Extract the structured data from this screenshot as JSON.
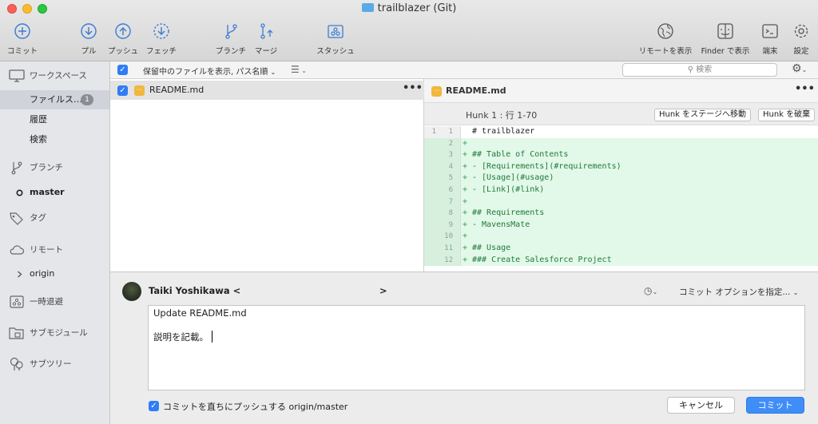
{
  "window": {
    "title": "trailblazer (Git)"
  },
  "toolbar": {
    "commit": "コミット",
    "pull": "プル",
    "push": "プッシュ",
    "fetch": "フェッチ",
    "branch": "ブランチ",
    "merge": "マージ",
    "stash": "スタッシュ",
    "show_remote": "リモートを表示",
    "show_in_finder": "Finder で表示",
    "terminal": "端末",
    "settings": "設定"
  },
  "sidebar": {
    "workspace": "ワークスペース",
    "file_status": "ファイルス…",
    "file_status_count": "1",
    "history": "履歴",
    "search": "検索",
    "branches": "ブランチ",
    "current_branch": "master",
    "tags": "タグ",
    "remotes": "リモート",
    "remote_origin": "origin",
    "stashes": "一時退避",
    "submodules": "サブモジュール",
    "subtrees": "サブツリー"
  },
  "filter": {
    "show_staged": "保留中のファイルを表示, パス名順",
    "search_placeholder": "検索"
  },
  "files": [
    {
      "name": "README.md"
    }
  ],
  "diff": {
    "file_name": "README.md",
    "hunk_label": "Hunk 1 : 行 1-70",
    "stage_hunk": "Hunk をステージへ移動",
    "discard_hunk": "Hunk を破棄",
    "lines": [
      {
        "old": "1",
        "new": "1",
        "mark": " ",
        "text": "# trailblazer",
        "added": false
      },
      {
        "old": "",
        "new": "2",
        "mark": "+",
        "text": "",
        "added": true
      },
      {
        "old": "",
        "new": "3",
        "mark": "+",
        "text": "## Table of Contents",
        "added": true
      },
      {
        "old": "",
        "new": "4",
        "mark": "+",
        "text": "- [Requirements](#requirements)",
        "added": true
      },
      {
        "old": "",
        "new": "5",
        "mark": "+",
        "text": "- [Usage](#usage)",
        "added": true
      },
      {
        "old": "",
        "new": "6",
        "mark": "+",
        "text": "- [Link](#link)",
        "added": true
      },
      {
        "old": "",
        "new": "7",
        "mark": "+",
        "text": "",
        "added": true
      },
      {
        "old": "",
        "new": "8",
        "mark": "+",
        "text": "## Requirements",
        "added": true
      },
      {
        "old": "",
        "new": "9",
        "mark": "+",
        "text": "- MavensMate",
        "added": true
      },
      {
        "old": "",
        "new": "10",
        "mark": "+",
        "text": "",
        "added": true
      },
      {
        "old": "",
        "new": "11",
        "mark": "+",
        "text": "## Usage",
        "added": true
      },
      {
        "old": "",
        "new": "12",
        "mark": "+",
        "text": "### Create Salesforce Project",
        "added": true
      }
    ]
  },
  "commit": {
    "author_name": "Taiki Yoshikawa <",
    "author_email_end": ">",
    "options": "コミット オプションを指定...",
    "message_line1": "Update README.md",
    "message_line2": "説明を記載。",
    "push_immediately": "コミットを直ちにプッシュする origin/master",
    "cancel": "キャンセル",
    "submit": "コミット"
  },
  "colors": {
    "accent": "#3f8df7",
    "added_bg": "#e2f8e8",
    "added_text": "#1f7a3b"
  }
}
